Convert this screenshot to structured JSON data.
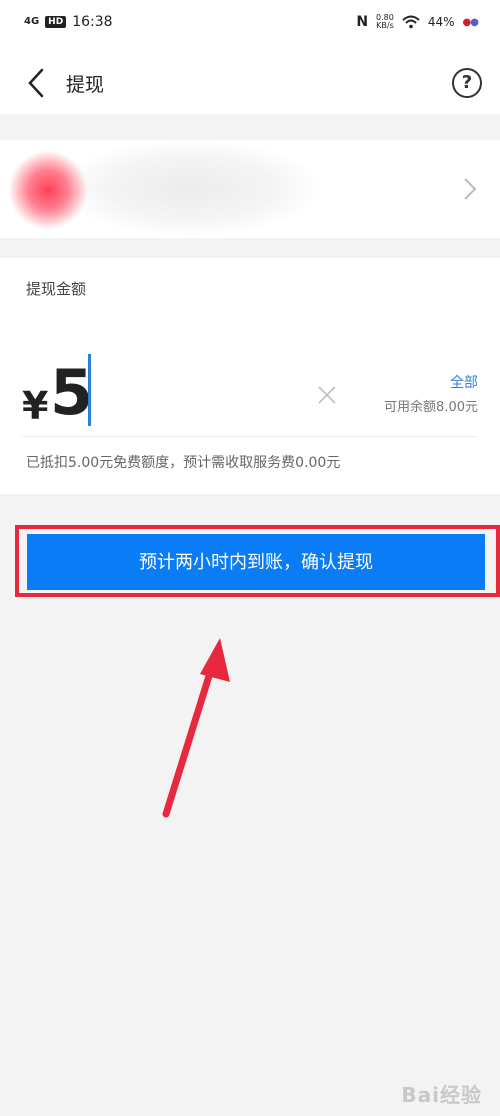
{
  "status_bar": {
    "signal": "4G",
    "hd": "HD",
    "time": "16:38",
    "net_speed_value": "0.80",
    "net_speed_unit": "KB/s",
    "battery": "44%"
  },
  "nav": {
    "title": "提现",
    "help": "?"
  },
  "amount_section": {
    "label": "提现金额",
    "currency": "¥",
    "value": "5",
    "all_label": "全部",
    "available_balance": "可用余额8.00元",
    "fee_note": "已抵扣5.00元免费额度，预计需收取服务费0.00元"
  },
  "confirm_button": {
    "label": "预计两小时内到账，确认提现"
  },
  "watermark": {
    "text": "Bai经验"
  },
  "colors": {
    "primary": "#0a7cf5",
    "highlight": "#e8283c",
    "background": "#f3f3f3"
  }
}
